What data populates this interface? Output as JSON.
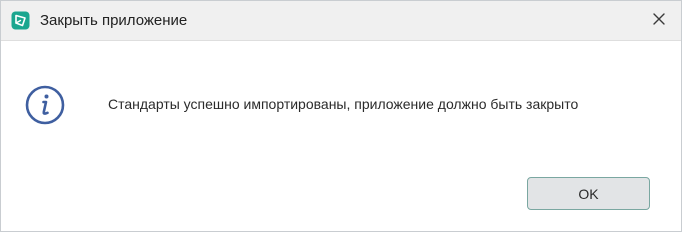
{
  "window": {
    "title": "Закрыть приложение",
    "app_icon": "app-logo-icon",
    "close_icon": "close-icon"
  },
  "content": {
    "icon": "info-icon",
    "message": "Стандарты успешно импортированы, приложение должно быть закрыто"
  },
  "buttons": {
    "ok_label": "OK"
  },
  "colors": {
    "accent": "#3f5fa0",
    "app_icon": "#1aa68f",
    "button_border": "#7aa7a1",
    "button_bg": "#e2e4e6",
    "titlebar_bg": "#f0f0f0"
  }
}
